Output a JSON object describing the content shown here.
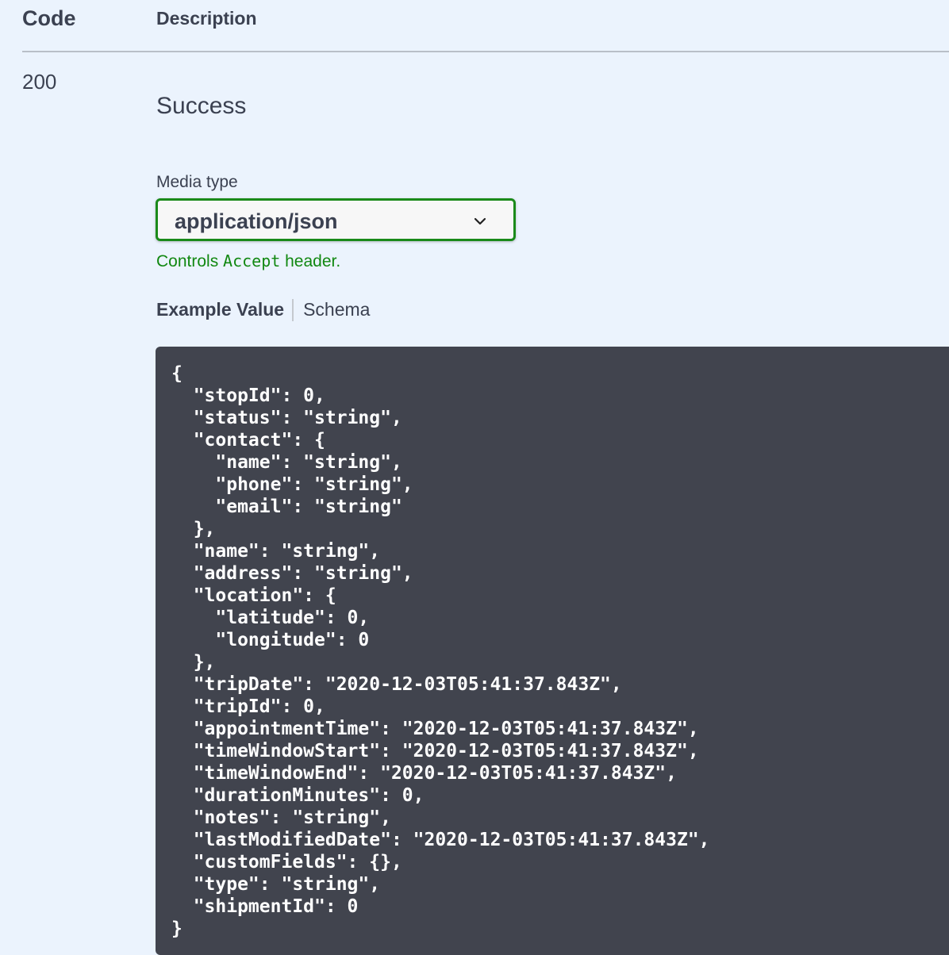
{
  "table_header": {
    "code": "Code",
    "description": "Description"
  },
  "response": {
    "code": "200",
    "description": "Success"
  },
  "media_type": {
    "label": "Media type",
    "selected": "application/json",
    "hint_prefix": "Controls ",
    "hint_code": "Accept",
    "hint_suffix": " header."
  },
  "tabs": {
    "example_value": "Example Value",
    "schema": "Schema"
  },
  "example_json": "{\n  \"stopId\": 0,\n  \"status\": \"string\",\n  \"contact\": {\n    \"name\": \"string\",\n    \"phone\": \"string\",\n    \"email\": \"string\"\n  },\n  \"name\": \"string\",\n  \"address\": \"string\",\n  \"location\": {\n    \"latitude\": 0,\n    \"longitude\": 0\n  },\n  \"tripDate\": \"2020-12-03T05:41:37.843Z\",\n  \"tripId\": 0,\n  \"appointmentTime\": \"2020-12-03T05:41:37.843Z\",\n  \"timeWindowStart\": \"2020-12-03T05:41:37.843Z\",\n  \"timeWindowEnd\": \"2020-12-03T05:41:37.843Z\",\n  \"durationMinutes\": 0,\n  \"notes\": \"string\",\n  \"lastModifiedDate\": \"2020-12-03T05:41:37.843Z\",\n  \"customFields\": {},\n  \"type\": \"string\",\n  \"shipmentId\": 0\n}",
  "colors": {
    "background": "#ebf3fd",
    "text": "#3b4151",
    "select_border": "#1a8a1a",
    "hint": "#118811",
    "code_background": "#41444e",
    "code_text": "#ffffff"
  },
  "icons": {
    "select_arrow": "chevron-down-icon"
  }
}
